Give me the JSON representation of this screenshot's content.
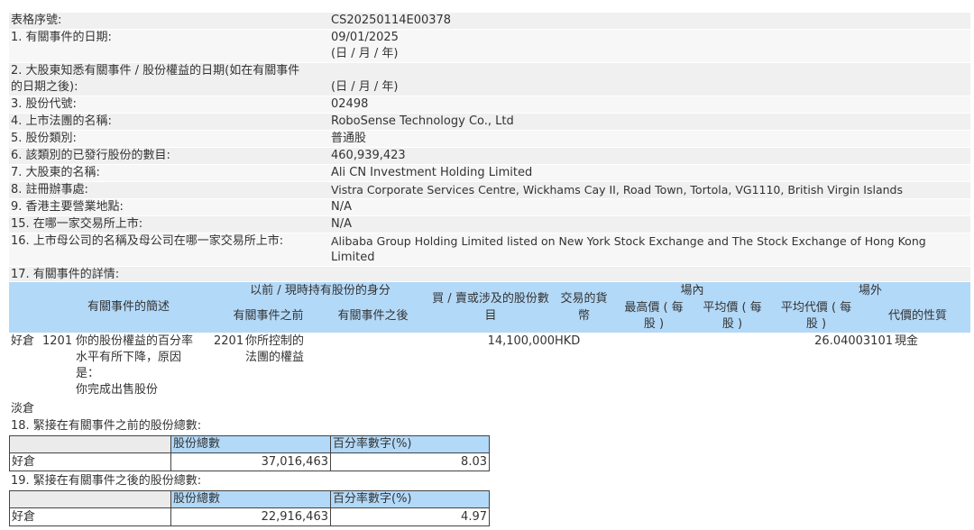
{
  "rows": [
    {
      "label": "表格序號:",
      "value": "CS20250114E00378"
    },
    {
      "label": "1. 有關事件的日期:",
      "value": "09/01/2025",
      "sub": "(日 / 月 / 年)"
    },
    {
      "label1": "2. 大股東知悉有關事件 / 股份權益的日期(如在有關事件",
      "label2": "的日期之後):",
      "value": "(日 / 月 / 年)"
    },
    {
      "label": "3. 股份代號:",
      "value": "02498"
    },
    {
      "label": "4. 上市法團的名稱:",
      "value": "RoboSense Technology Co., Ltd"
    },
    {
      "label": "5. 股份類別:",
      "value": "普通股"
    },
    {
      "label": "6. 該類別的已發行股份的數目:",
      "value": "460,939,423"
    },
    {
      "label": "7. 大股東的名稱:",
      "value": "Ali CN Investment Holding Limited"
    },
    {
      "label": "8. 註冊辦事處:",
      "value": "Vistra Corporate Services Centre, Wickhams Cay II, Road Town, Tortola, VG1110, British Virgin Islands"
    },
    {
      "label": "9. 香港主要營業地點:",
      "value": "N/A"
    },
    {
      "label": "15. 在哪一家交易所上市:",
      "value": "N/A"
    },
    {
      "label": "16. 上市母公司的名稱及母公司在哪一家交易所上市:",
      "value1": "Alibaba Group Holding Limited listed on New York Stock Exchange and The Stock Exchange of Hong Kong",
      "value2": "Limited"
    }
  ],
  "section17": {
    "title": "17. 有關事件的詳情:",
    "headers": {
      "brief": "有關事件的簡述",
      "identity": "以前 / 現時持有股份的身分",
      "before": "有關事件之前",
      "after": "有關事件之後",
      "shares1": "買 / 賣或涉及的股份數",
      "shares2": "目",
      "currency1": "交易的貨",
      "currency2": "幣",
      "onexch": "場內",
      "offexch": "場外",
      "highest1": "最高價 ( 每",
      "highest2": "股 )",
      "avg1": "平均價 ( 每",
      "avg2": "股 )",
      "avgconsid1": "平均代價 ( 每",
      "avgconsid2": "股 )",
      "nature": "代價的性質"
    },
    "entry": {
      "position": "好倉",
      "code": "1201",
      "brief1": "你的股份權益的百分率",
      "brief2": "水平有所下降，原因",
      "brief3": "是：",
      "brief4": "你完成出售股份",
      "before_code": "2201",
      "before1": "你所控制的",
      "before2": "法團的權益",
      "shares": "14,100,000",
      "currency": "HKD",
      "avgconsid": "26.04003101",
      "nature": "現金"
    },
    "short": "淡倉"
  },
  "section18": {
    "title": "18. 緊接在有關事件之前的股份總數:",
    "col1": "股份總數",
    "col2": "百分率數字(%)",
    "row_label": "好倉",
    "total": "37,016,463",
    "pct": "8.03"
  },
  "section19": {
    "title": "19. 緊接在有關事件之後的股份總數:",
    "col1": "股份總數",
    "col2": "百分率數字(%)",
    "row_label": "好倉",
    "total": "22,916,463",
    "pct": "4.97"
  }
}
